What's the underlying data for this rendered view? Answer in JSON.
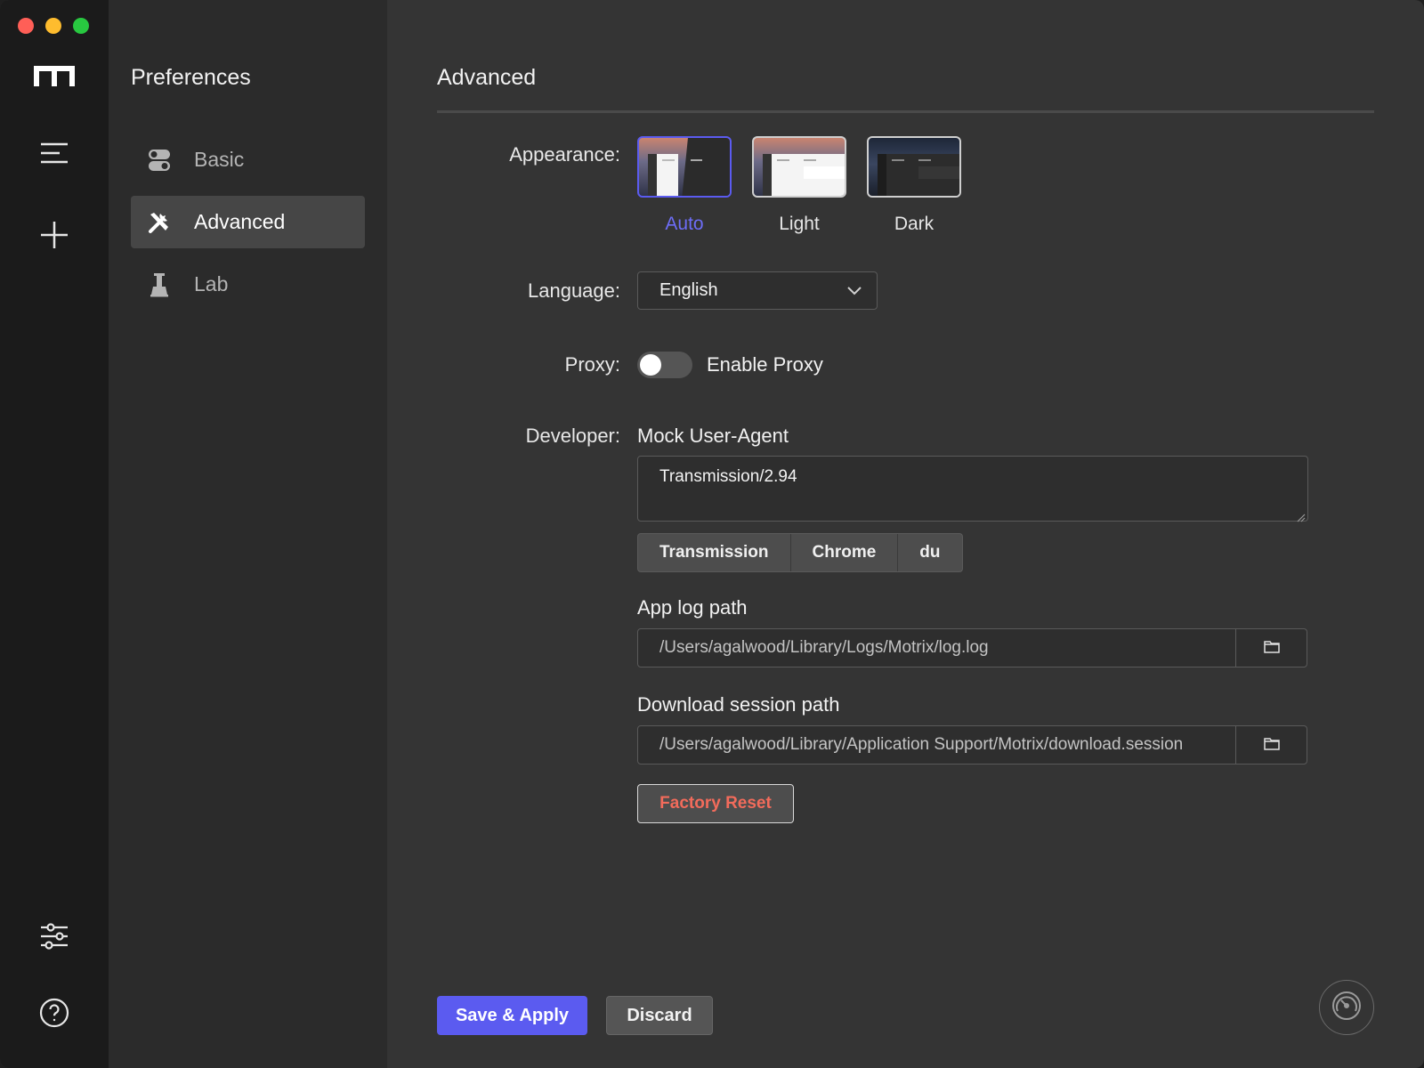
{
  "window": {
    "traffic_colors": [
      "#ff5f57",
      "#febc2e",
      "#28c840"
    ]
  },
  "rail": {
    "items": [
      {
        "name": "logo",
        "icon": "motrix-logo-icon"
      },
      {
        "name": "menu",
        "icon": "menu-icon"
      },
      {
        "name": "add",
        "icon": "plus-icon"
      },
      {
        "name": "preferences",
        "icon": "sliders-icon"
      },
      {
        "name": "help",
        "icon": "help-circle-icon"
      }
    ]
  },
  "sidebar": {
    "title": "Preferences",
    "items": [
      {
        "label": "Basic",
        "icon": "toggles-icon",
        "active": false
      },
      {
        "label": "Advanced",
        "icon": "tools-icon",
        "active": true
      },
      {
        "label": "Lab",
        "icon": "flask-icon",
        "active": false
      }
    ]
  },
  "main": {
    "title": "Advanced",
    "appearance": {
      "label": "Appearance:",
      "options": [
        {
          "label": "Auto",
          "selected": true
        },
        {
          "label": "Light",
          "selected": false
        },
        {
          "label": "Dark",
          "selected": false
        }
      ]
    },
    "language": {
      "label": "Language:",
      "value": "English"
    },
    "proxy": {
      "label": "Proxy:",
      "toggle_label": "Enable Proxy",
      "enabled": false
    },
    "developer": {
      "label": "Developer:",
      "ua_label": "Mock User-Agent",
      "ua_value": "Transmission/2.94",
      "ua_presets": [
        "Transmission",
        "Chrome",
        "du"
      ],
      "log_label": "App log path",
      "log_path": "/Users/agalwood/Library/Logs/Motrix/log.log",
      "session_label": "Download session path",
      "session_path": "/Users/agalwood/Library/Application Support/Motrix/download.session",
      "reset_label": "Factory Reset"
    },
    "actions": {
      "save_label": "Save & Apply",
      "discard_label": "Discard"
    }
  },
  "colors": {
    "accent": "#5b5bf0",
    "danger": "#f26b5b"
  }
}
